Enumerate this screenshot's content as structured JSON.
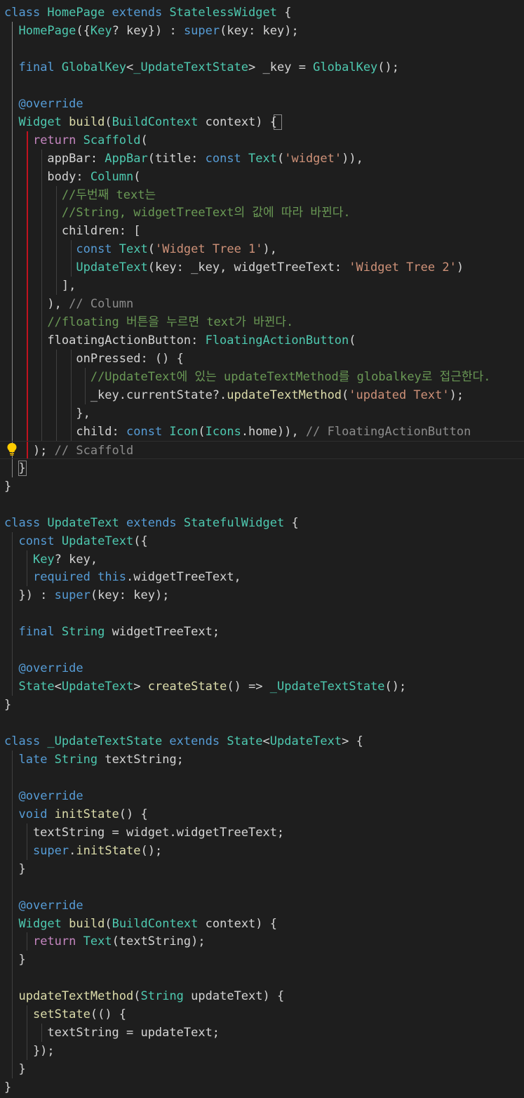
{
  "editor": {
    "theme": "dark",
    "background": "#1e1e1e",
    "colors": {
      "keyword": "#569cd6",
      "control": "#c586c0",
      "type": "#4ec9b0",
      "function": "#dcdcaa",
      "string": "#ce9178",
      "comment": "#6a9955",
      "closing_label": "#8c8c8c",
      "text": "#d4d4d4",
      "lightbulb": "#ffcc00"
    },
    "lightbulb_icon": "lightbulb-icon",
    "lines": [
      [
        [
          "kw",
          "class "
        ],
        [
          "type",
          "HomePage "
        ],
        [
          "kw",
          "extends "
        ],
        [
          "type",
          "StatelessWidget "
        ],
        [
          "plain",
          "{"
        ]
      ],
      [
        [
          "plain",
          "  "
        ],
        [
          "type",
          "HomePage"
        ],
        [
          "plain",
          "({"
        ],
        [
          "type",
          "Key"
        ],
        [
          "plain",
          "? key}) : "
        ],
        [
          "kw",
          "super"
        ],
        [
          "plain",
          "(key: key);"
        ]
      ],
      [],
      [
        [
          "plain",
          "  "
        ],
        [
          "kw",
          "final "
        ],
        [
          "type",
          "GlobalKey"
        ],
        [
          "plain",
          "<"
        ],
        [
          "type",
          "_UpdateTextState"
        ],
        [
          "plain",
          "> _key = "
        ],
        [
          "type",
          "GlobalKey"
        ],
        [
          "plain",
          "();"
        ]
      ],
      [],
      [
        [
          "plain",
          "  "
        ],
        [
          "kw",
          "@override"
        ]
      ],
      [
        [
          "plain",
          "  "
        ],
        [
          "type",
          "Widget "
        ],
        [
          "fn",
          "build"
        ],
        [
          "plain",
          "("
        ],
        [
          "type",
          "BuildContext "
        ],
        [
          "plain",
          "context) {"
        ]
      ],
      [
        [
          "plain",
          "    "
        ],
        [
          "ctl",
          "return "
        ],
        [
          "type",
          "Scaffold"
        ],
        [
          "plain",
          "("
        ]
      ],
      [
        [
          "plain",
          "      appBar: "
        ],
        [
          "type",
          "AppBar"
        ],
        [
          "plain",
          "(title: "
        ],
        [
          "kw",
          "const "
        ],
        [
          "type",
          "Text"
        ],
        [
          "plain",
          "("
        ],
        [
          "str",
          "'widget'"
        ],
        [
          "plain",
          ")),"
        ]
      ],
      [
        [
          "plain",
          "      body: "
        ],
        [
          "type",
          "Column"
        ],
        [
          "plain",
          "("
        ]
      ],
      [
        [
          "plain",
          "        "
        ],
        [
          "cm",
          "//두번째 text는"
        ]
      ],
      [
        [
          "plain",
          "        "
        ],
        [
          "cm",
          "//String, widgetTreeText의 값에 따라 바뀐다."
        ]
      ],
      [
        [
          "plain",
          "        children: ["
        ]
      ],
      [
        [
          "plain",
          "          "
        ],
        [
          "kw",
          "const "
        ],
        [
          "type",
          "Text"
        ],
        [
          "plain",
          "("
        ],
        [
          "str",
          "'Widget Tree 1'"
        ],
        [
          "plain",
          "),"
        ]
      ],
      [
        [
          "plain",
          "          "
        ],
        [
          "type",
          "UpdateText"
        ],
        [
          "plain",
          "(key: _key, widgetTreeText: "
        ],
        [
          "str",
          "'Widget Tree 2'"
        ],
        [
          "plain",
          ")"
        ]
      ],
      [
        [
          "plain",
          "        ],"
        ]
      ],
      [
        [
          "plain",
          "      ), "
        ],
        [
          "cmg",
          "// Column"
        ]
      ],
      [
        [
          "plain",
          "      "
        ],
        [
          "cm",
          "//floating 버튼을 누르면 text가 바뀐다."
        ]
      ],
      [
        [
          "plain",
          "      floatingActionButton: "
        ],
        [
          "type",
          "FloatingActionButton"
        ],
        [
          "plain",
          "("
        ]
      ],
      [
        [
          "plain",
          "          onPressed: () {"
        ]
      ],
      [
        [
          "plain",
          "            "
        ],
        [
          "cm",
          "//UpdateText에 있는 updateTextMethod를 globalkey로 접근한다."
        ]
      ],
      [
        [
          "plain",
          "            _key.currentState?."
        ],
        [
          "fn",
          "updateTextMethod"
        ],
        [
          "plain",
          "("
        ],
        [
          "str",
          "'updated Text'"
        ],
        [
          "plain",
          ");"
        ]
      ],
      [
        [
          "plain",
          "          },"
        ]
      ],
      [
        [
          "plain",
          "          child: "
        ],
        [
          "kw",
          "const "
        ],
        [
          "type",
          "Icon"
        ],
        [
          "plain",
          "("
        ],
        [
          "type",
          "Icons"
        ],
        [
          "plain",
          ".home)), "
        ],
        [
          "cmg",
          "// FloatingActionButton"
        ]
      ],
      [
        [
          "plain",
          "    ); "
        ],
        [
          "cmg",
          "// Scaffold"
        ]
      ],
      [
        [
          "plain",
          "  }"
        ]
      ],
      [
        [
          "plain",
          "}"
        ]
      ],
      [],
      [
        [
          "kw",
          "class "
        ],
        [
          "type",
          "UpdateText "
        ],
        [
          "kw",
          "extends "
        ],
        [
          "type",
          "StatefulWidget "
        ],
        [
          "plain",
          "{"
        ]
      ],
      [
        [
          "plain",
          "  "
        ],
        [
          "kw",
          "const "
        ],
        [
          "type",
          "UpdateText"
        ],
        [
          "plain",
          "({"
        ]
      ],
      [
        [
          "plain",
          "    "
        ],
        [
          "type",
          "Key"
        ],
        [
          "plain",
          "? key,"
        ]
      ],
      [
        [
          "plain",
          "    "
        ],
        [
          "kw",
          "required "
        ],
        [
          "kw",
          "this"
        ],
        [
          "plain",
          ".widgetTreeText,"
        ]
      ],
      [
        [
          "plain",
          "  }) : "
        ],
        [
          "kw",
          "super"
        ],
        [
          "plain",
          "(key: key);"
        ]
      ],
      [],
      [
        [
          "plain",
          "  "
        ],
        [
          "kw",
          "final "
        ],
        [
          "type",
          "String "
        ],
        [
          "plain",
          "widgetTreeText;"
        ]
      ],
      [],
      [
        [
          "plain",
          "  "
        ],
        [
          "kw",
          "@override"
        ]
      ],
      [
        [
          "plain",
          "  "
        ],
        [
          "type",
          "State"
        ],
        [
          "plain",
          "<"
        ],
        [
          "type",
          "UpdateText"
        ],
        [
          "plain",
          "> "
        ],
        [
          "fn",
          "createState"
        ],
        [
          "plain",
          "() => "
        ],
        [
          "type",
          "_UpdateTextState"
        ],
        [
          "plain",
          "();"
        ]
      ],
      [
        [
          "plain",
          "}"
        ]
      ],
      [],
      [
        [
          "kw",
          "class "
        ],
        [
          "type",
          "_UpdateTextState "
        ],
        [
          "kw",
          "extends "
        ],
        [
          "type",
          "State"
        ],
        [
          "plain",
          "<"
        ],
        [
          "type",
          "UpdateText"
        ],
        [
          "plain",
          "> {"
        ]
      ],
      [
        [
          "plain",
          "  "
        ],
        [
          "kw",
          "late "
        ],
        [
          "type",
          "String "
        ],
        [
          "plain",
          "textString;"
        ]
      ],
      [],
      [
        [
          "plain",
          "  "
        ],
        [
          "kw",
          "@override"
        ]
      ],
      [
        [
          "plain",
          "  "
        ],
        [
          "kw",
          "void "
        ],
        [
          "fn",
          "initState"
        ],
        [
          "plain",
          "() {"
        ]
      ],
      [
        [
          "plain",
          "    textString = widget.widgetTreeText;"
        ]
      ],
      [
        [
          "plain",
          "    "
        ],
        [
          "kw",
          "super"
        ],
        [
          "plain",
          "."
        ],
        [
          "fn",
          "initState"
        ],
        [
          "plain",
          "();"
        ]
      ],
      [
        [
          "plain",
          "  }"
        ]
      ],
      [],
      [
        [
          "plain",
          "  "
        ],
        [
          "kw",
          "@override"
        ]
      ],
      [
        [
          "plain",
          "  "
        ],
        [
          "type",
          "Widget "
        ],
        [
          "fn",
          "build"
        ],
        [
          "plain",
          "("
        ],
        [
          "type",
          "BuildContext "
        ],
        [
          "plain",
          "context) {"
        ]
      ],
      [
        [
          "plain",
          "    "
        ],
        [
          "ctl",
          "return "
        ],
        [
          "type",
          "Text"
        ],
        [
          "plain",
          "(textString);"
        ]
      ],
      [
        [
          "plain",
          "  }"
        ]
      ],
      [],
      [
        [
          "plain",
          "  "
        ],
        [
          "fn",
          "updateTextMethod"
        ],
        [
          "plain",
          "("
        ],
        [
          "type",
          "String "
        ],
        [
          "plain",
          "updateText) {"
        ]
      ],
      [
        [
          "plain",
          "    "
        ],
        [
          "fn",
          "setState"
        ],
        [
          "plain",
          "(() {"
        ]
      ],
      [
        [
          "plain",
          "      textString = updateText;"
        ]
      ],
      [
        [
          "plain",
          "    });"
        ]
      ],
      [
        [
          "plain",
          "  }"
        ]
      ],
      [
        [
          "plain",
          "}"
        ]
      ]
    ]
  }
}
